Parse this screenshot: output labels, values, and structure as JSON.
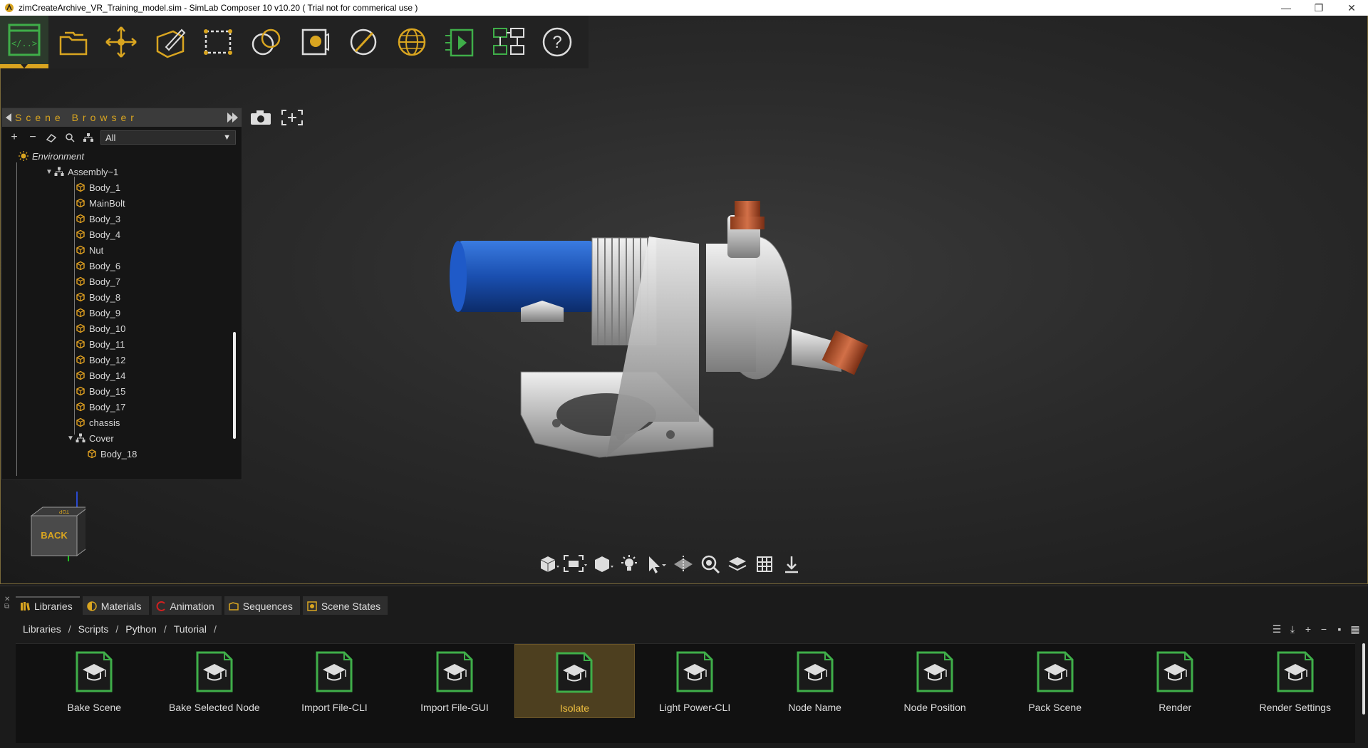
{
  "window": {
    "title": "zimCreateArchive_VR_Training_model.sim - SimLab Composer 10 v10.20 ( Trial not for commerical use )",
    "minimize": "—",
    "restore": "❐",
    "close": "✕"
  },
  "main_toolbar": {
    "buttons": [
      {
        "name": "scripting-mode",
        "icon": "code-window-icon",
        "active": true
      },
      {
        "name": "open",
        "icon": "folders-icon"
      },
      {
        "name": "move",
        "icon": "transform-icon"
      },
      {
        "name": "modeling",
        "icon": "pen-box-icon"
      },
      {
        "name": "selection",
        "icon": "dotted-rect-icon"
      },
      {
        "name": "materials",
        "icon": "spheres-icon"
      },
      {
        "name": "render",
        "icon": "camera-render-icon"
      },
      {
        "name": "mapping",
        "icon": "slash-circle-icon"
      },
      {
        "name": "web",
        "icon": "globe-icon"
      },
      {
        "name": "animation",
        "icon": "play-film-icon"
      },
      {
        "name": "vr-flow",
        "icon": "flow-diagram-icon"
      },
      {
        "name": "help",
        "icon": "help-icon"
      }
    ]
  },
  "scene_browser": {
    "title": "Scene Browser",
    "filter": "All",
    "tree": [
      {
        "label": "Environment",
        "type": "env",
        "level": 0
      },
      {
        "label": "Assembly~1",
        "type": "assembly",
        "level": 1,
        "expanded": true
      },
      {
        "label": "Body_1",
        "type": "body",
        "level": 2
      },
      {
        "label": "MainBolt",
        "type": "body",
        "level": 2
      },
      {
        "label": "Body_3",
        "type": "body",
        "level": 2
      },
      {
        "label": "Body_4",
        "type": "body",
        "level": 2
      },
      {
        "label": "Nut",
        "type": "body",
        "level": 2
      },
      {
        "label": "Body_6",
        "type": "body",
        "level": 2
      },
      {
        "label": "Body_7",
        "type": "body",
        "level": 2
      },
      {
        "label": "Body_8",
        "type": "body",
        "level": 2
      },
      {
        "label": "Body_9",
        "type": "body",
        "level": 2
      },
      {
        "label": "Body_10",
        "type": "body",
        "level": 2
      },
      {
        "label": "Body_11",
        "type": "body",
        "level": 2
      },
      {
        "label": "Body_12",
        "type": "body",
        "level": 2
      },
      {
        "label": "Body_14",
        "type": "body",
        "level": 2
      },
      {
        "label": "Body_15",
        "type": "body",
        "level": 2
      },
      {
        "label": "Body_17",
        "type": "body",
        "level": 2
      },
      {
        "label": "chassis",
        "type": "body",
        "level": 2
      },
      {
        "label": "Cover",
        "type": "assembly",
        "level": 2,
        "expanded": true
      },
      {
        "label": "Body_18",
        "type": "body",
        "level": 3
      }
    ]
  },
  "navcube": {
    "face": "BACK",
    "top_face": "TOP"
  },
  "bottom_panel": {
    "tabs": [
      {
        "label": "Libraries",
        "active": true
      },
      {
        "label": "Materials"
      },
      {
        "label": "Animation"
      },
      {
        "label": "Sequences"
      },
      {
        "label": "Scene States"
      }
    ],
    "breadcrumb": [
      "Libraries",
      "Scripts",
      "Python",
      "Tutorial"
    ],
    "items": [
      {
        "label": "Bake Scene"
      },
      {
        "label": "Bake Selected Node"
      },
      {
        "label": "Import File-CLI"
      },
      {
        "label": "Import File-GUI"
      },
      {
        "label": "Isolate",
        "selected": true
      },
      {
        "label": "Light Power-CLI"
      },
      {
        "label": "Node Name"
      },
      {
        "label": "Node Position"
      },
      {
        "label": "Pack Scene"
      },
      {
        "label": "Render"
      },
      {
        "label": "Render Settings"
      }
    ]
  },
  "colors": {
    "accent": "#d9a520",
    "icon_green": "#3fae49",
    "selected_bg": "#4d3f1f"
  }
}
